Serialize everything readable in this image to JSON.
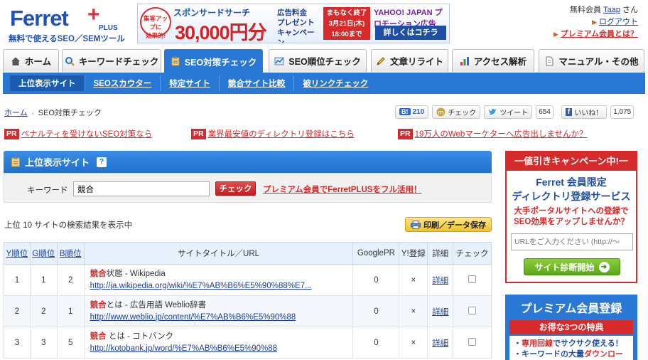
{
  "logo": {
    "word": "Ferret",
    "plus_word": "PLUS",
    "subtitle": "無料で使えるSEO／SEMツール"
  },
  "banner": {
    "badge_line1": "集客アップに",
    "badge_line2": "効果的!",
    "title": "スポンサードサーチ",
    "price": "30,000円分",
    "mid_line1": "広告料金",
    "mid_line2": "プレゼント",
    "mid_line3": "キャンペーン",
    "deadline_line1": "まもなく終了",
    "deadline_line2": "3月21日(木)",
    "deadline_line3": "18:00まで",
    "partner": "YAHOO! JAPAN プロモーション広告",
    "details_button": "詳しくはコチラ"
  },
  "user": {
    "member_type": "無料会員",
    "name": "Taap",
    "honorific": "さん",
    "logout": "ログアウト",
    "premium_link": "プレミアム会員とは？"
  },
  "tabs": [
    {
      "label": "ホーム",
      "icon": "home-icon"
    },
    {
      "label": "キーワードチェック",
      "icon": "magnifier-icon"
    },
    {
      "label": "SEO対策チェック",
      "icon": "clipboard-icon",
      "active": true
    },
    {
      "label": "SEO順位チェック",
      "icon": "chart-icon"
    },
    {
      "label": "文章リライト",
      "icon": "pencil-icon"
    },
    {
      "label": "アクセス解析",
      "icon": "bar-chart-icon"
    },
    {
      "label": "マニュアル・その他",
      "icon": "document-icon"
    }
  ],
  "subnav": [
    "上位表示サイト",
    "SEOスカウター",
    "特定サイト",
    "競合サイト比較",
    "被リンクチェック"
  ],
  "breadcrumb": {
    "home": "ホーム",
    "current": "SEO対策チェック"
  },
  "social": {
    "hatena_label": "B!",
    "hatena_count": "210",
    "check_label": "チェック",
    "tweet_label": "ツイート",
    "tweet_count": "654",
    "like_label": "いいね！",
    "like_count": "1,075"
  },
  "pr": [
    {
      "badge": "PR",
      "text": "ペナルティを受けないSEO対策なら"
    },
    {
      "badge": "PR",
      "text": "業界最安値のディレクトリ登録はこちら"
    },
    {
      "badge": "PR",
      "text": "19万人のWebマーケターへ広告出しませんか？"
    }
  ],
  "panel": {
    "title": "上位表示サイト",
    "help": "?",
    "keyword_label": "キーワード",
    "keyword_value": "競合",
    "check_button": "チェック",
    "premium_cta": "プレミアム会員でFerretPLUSをフル活用！",
    "summary": "上位 10 サイトの検索結果を表示中",
    "print_button": "印刷／データ保存"
  },
  "table": {
    "headers": [
      "Y順位",
      "G順位",
      "B順位",
      "サイトタイトル／URL",
      "GooglePR",
      "Y!登録",
      "詳細",
      "チェック"
    ],
    "rows": [
      {
        "y": "1",
        "g": "1",
        "b": "2",
        "title_kw": "競合",
        "title_rest": "状態 - Wikipedia",
        "url": "http://ja.wikipedia.org/wiki/%E7%AB%B6%E5%90%88%E7...",
        "pr": "0",
        "yreg": "×",
        "detail": "詳細"
      },
      {
        "y": "2",
        "g": "2",
        "b": "1",
        "title_kw": "競合",
        "title_rest": "とは - 広告用語 Weblio辞書",
        "url": "http://www.weblio.jp/content/%E7%AB%B6%E5%90%88",
        "pr": "0",
        "yreg": "×",
        "detail": "詳細"
      },
      {
        "y": "3",
        "g": "3",
        "b": "5",
        "title_kw": "競合",
        "title_rest": " とは - コトバンク",
        "url": "http://kotobank.jp/word/%E7%AB%B6%E5%90%88",
        "pr": "0",
        "yreg": "×",
        "detail": "詳細"
      }
    ]
  },
  "sidebar": {
    "campaign_header": "一値引きキャンペーン中!一",
    "service_line1": "Ferret 会員限定",
    "service_line2": "ディレクトリ登録サービス",
    "service_desc1": "大手ポータルサイトへの登録で",
    "service_desc2": "SEO効果をアップしませんか？",
    "url_placeholder": "URLをご入力ください (http://～",
    "diagnose_button": "サイト診断開始",
    "premium_header": "プレミアム会員登録",
    "benefits_header": "お得な3つの特典",
    "benefit1_hl": "専用回線",
    "benefit1_rest": "でサクサク使える！",
    "benefit2_prefix": "キーワードの大量",
    "benefit2_hl": "ダウンロード!"
  },
  "colors": {
    "brand_blue": "#2a78d6",
    "accent_red": "#d72a2a",
    "link_blue": "#1c3ea0"
  }
}
